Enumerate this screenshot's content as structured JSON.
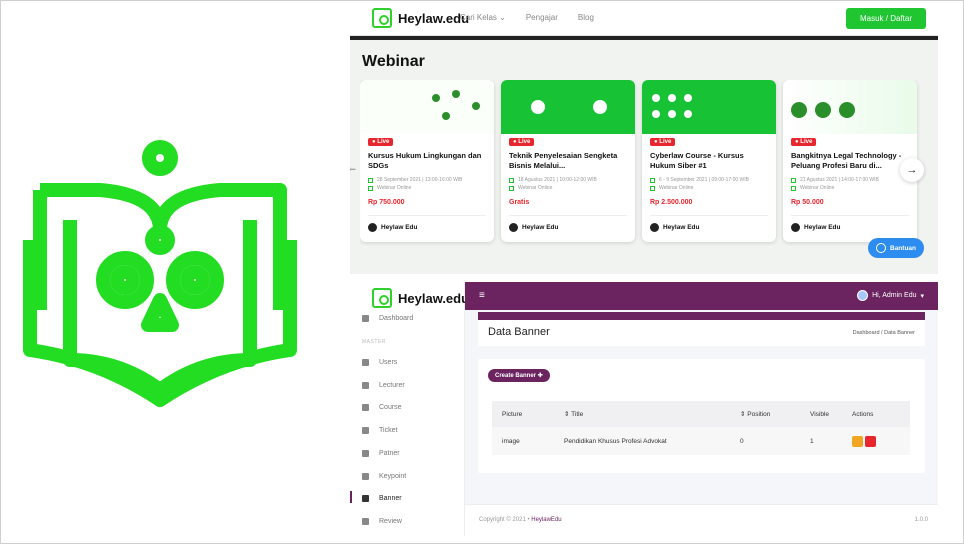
{
  "colors": {
    "brand_green": "#22dd22",
    "site_green": "#1fc632",
    "admin_purple": "#6b2460",
    "live_red": "#e8262d"
  },
  "site": {
    "brand": "Heylaw.edu",
    "nav": [
      "Cari Kelas",
      "Pengajar",
      "Blog"
    ],
    "login": "Masuk / Daftar",
    "section_title": "Webinar",
    "cards": [
      {
        "badge": "Live",
        "title": "Kursus Hukum Lingkungan dan SDGs",
        "date": "28 September 2021 | 13:00-16:00 WIB",
        "mode": "Webinar Online",
        "price": "Rp 750.000",
        "author": "Heylaw Edu"
      },
      {
        "badge": "Live",
        "title": "Teknik Penyelesaian Sengketa Bisnis Melalui...",
        "date": "18 Agustus 2021 | 10:00-12:00 WIB",
        "mode": "Webinar Online",
        "price": "Gratis",
        "author": "Heylaw Edu"
      },
      {
        "badge": "Live",
        "title": "Cyberlaw Course - Kursus Hukum Siber #1",
        "date": "6 - 9 September 2021 | 09:00-17:00 WIB",
        "mode": "Webinar Online",
        "price": "Rp 2.500.000",
        "author": "Heylaw Edu"
      },
      {
        "badge": "Live",
        "title": "Bangkitnya Legal Technology - Peluang Profesi Baru di...",
        "date": "21 Agustus 2021 | 14:00-17:00 WIB",
        "mode": "Webinar Online",
        "price": "Rp 50.000",
        "author": "Heylaw Edu"
      }
    ],
    "help": "Bantuan"
  },
  "admin": {
    "brand": "Heylaw.edu",
    "user": "Hi, Admin Edu",
    "section_label": "MASTER",
    "menu": [
      "Dashboard",
      "Users",
      "Lecturer",
      "Course",
      "Ticket",
      "Patner",
      "Keypoint",
      "Banner",
      "Review"
    ],
    "page_title": "Data Banner",
    "breadcrumb": "Dashboard / Data Banner",
    "create_button": "Create Banner",
    "table": {
      "headers": [
        "Picture",
        "Title",
        "Position",
        "Visible",
        "Actions"
      ],
      "rows": [
        [
          "image",
          "Pendidikan Khusus Profesi Advokat",
          "0",
          "1"
        ]
      ]
    },
    "footer": {
      "copyright": "Copyright © 2021 •",
      "brand_link": "HeylawEdu",
      "version": "1.0.0"
    }
  }
}
